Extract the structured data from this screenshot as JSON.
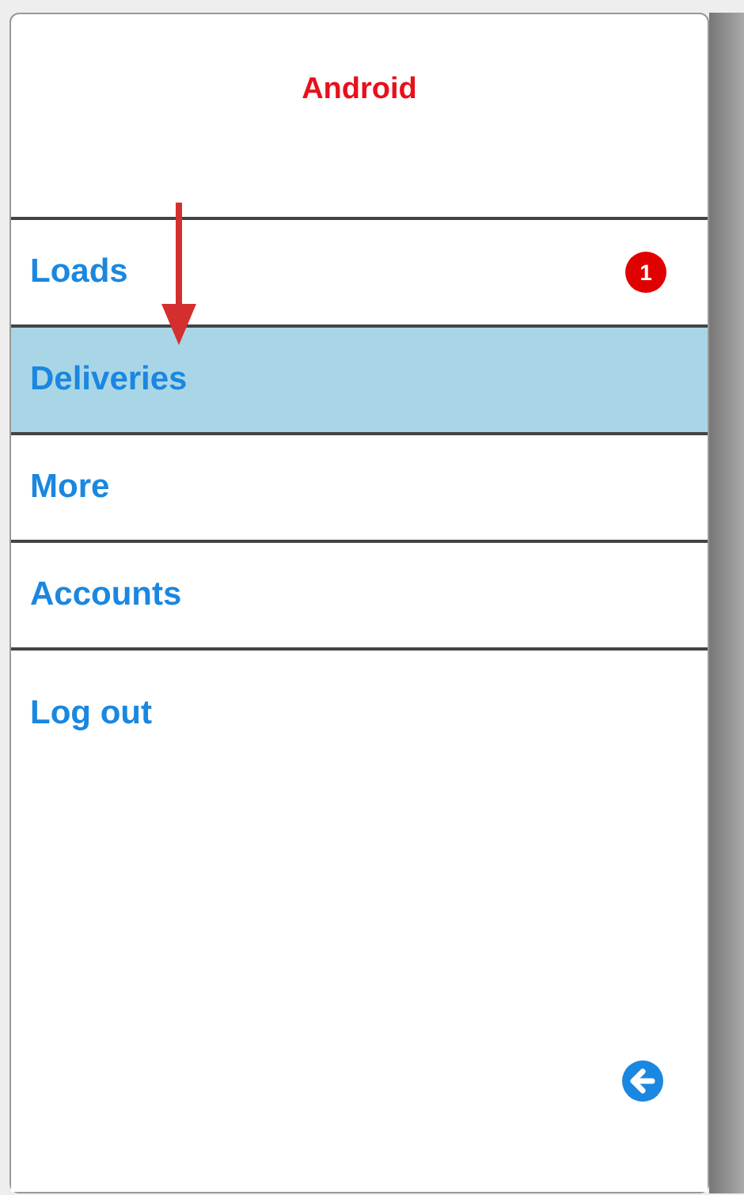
{
  "header": {
    "title": "Android"
  },
  "menu": [
    {
      "label": "Loads",
      "selected": false,
      "badge": "1"
    },
    {
      "label": "Deliveries",
      "selected": true
    },
    {
      "label": "More",
      "selected": false
    },
    {
      "label": "Accounts",
      "selected": false
    },
    {
      "label": "Log out",
      "selected": false
    }
  ]
}
